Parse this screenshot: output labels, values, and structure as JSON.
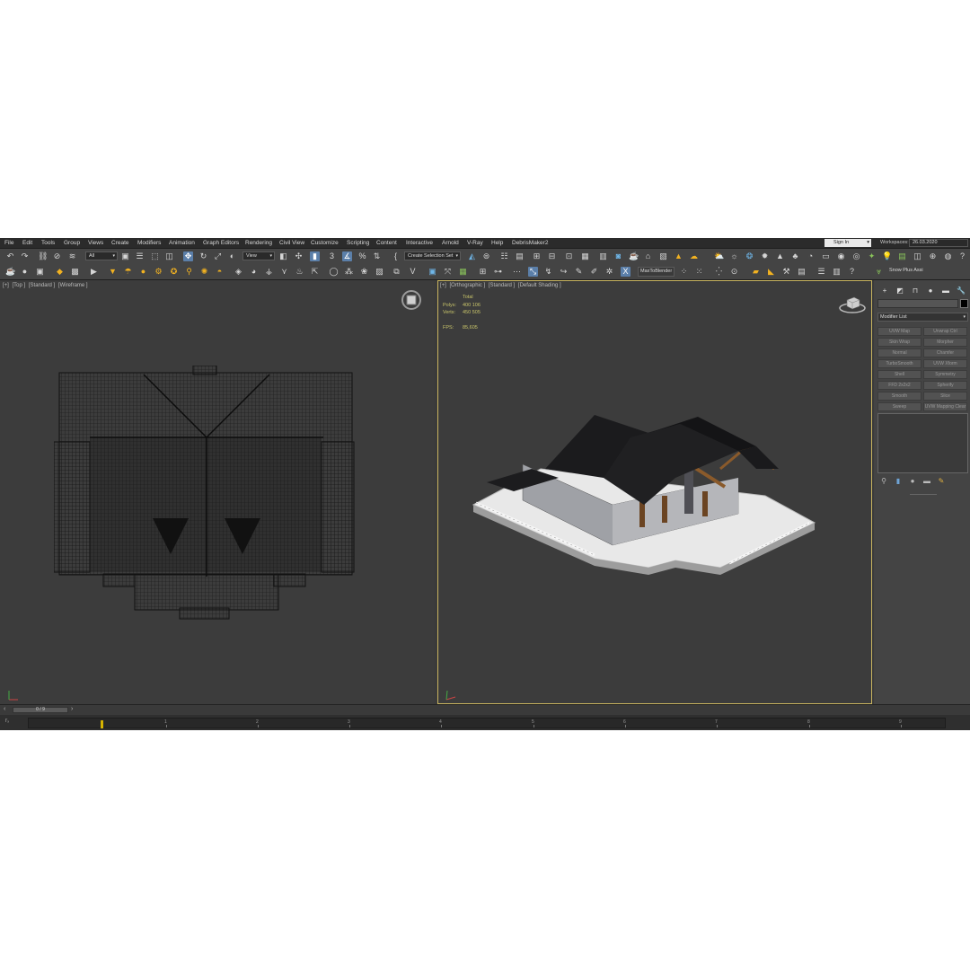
{
  "menu": [
    "File",
    "Edit",
    "Tools",
    "Group",
    "Views",
    "Create",
    "Modifiers",
    "Animation",
    "Graph Editors",
    "Rendering",
    "Civil View",
    "Customize",
    "Scripting",
    "Content",
    "Interactive",
    "Arnold",
    "V-Ray",
    "Help",
    "DebrisMaker2"
  ],
  "signin": {
    "label": "Sign In"
  },
  "workspaces": {
    "label": "Workspaces:",
    "value": "26.03.2020"
  },
  "toolbar": {
    "filter_dropdown": "All",
    "coord_dropdown": "View",
    "selection_set": "Create Selection Set",
    "max_to_blender": "MaxToBlender",
    "snow_plus": "Snow Plus Assi"
  },
  "viewport_left": {
    "label": [
      "[+]",
      "[Top ]",
      "[Standard ]",
      "[Wireframe ]"
    ]
  },
  "viewport_right": {
    "label": [
      "[+]",
      "[Orthographic ]",
      "[Standard ]",
      "[Default Shading ]"
    ],
    "stats": {
      "header": "Total",
      "polys_label": "Polys:",
      "polys_value": "400 106",
      "verts_label": "Verts:",
      "verts_value": "450 505",
      "fps_label": "FPS:",
      "fps_value": "85,605"
    }
  },
  "panel": {
    "modifier_list": "Modifier List",
    "modifiers": [
      "UVW Map",
      "Unwrap Ctrl",
      "Skin Wrap",
      "Morpher",
      "Normal",
      "Chamfer",
      "TurboSmooth",
      "UVW Xform",
      "Shell",
      "Symmetry",
      "FFD 2x2x2",
      "Spherify",
      "Smooth",
      "Slice",
      "Sweep",
      "UVW Mapping Clear"
    ]
  },
  "timeline": {
    "slider": "0 / 9",
    "ticks": [
      "1",
      "2",
      "3",
      "4",
      "5",
      "6",
      "7",
      "8",
      "9"
    ]
  }
}
